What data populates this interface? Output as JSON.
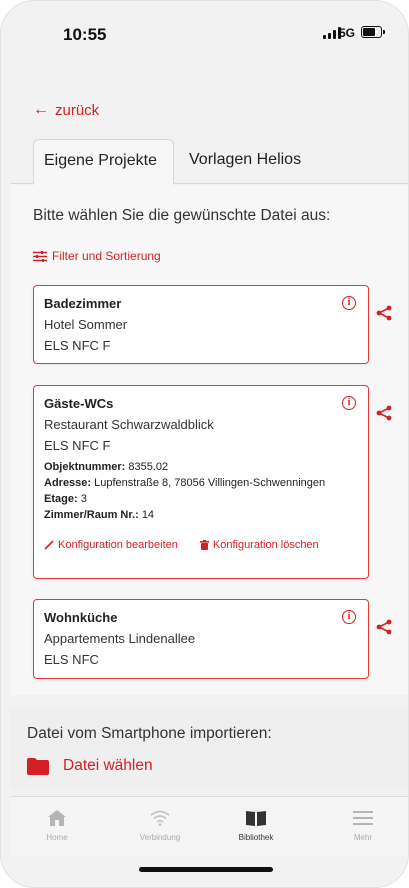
{
  "status": {
    "time": "10:55",
    "network": "5G"
  },
  "nav": {
    "back_label": "zurück"
  },
  "tabs": [
    {
      "label": "Eigene Projekte",
      "active": true
    },
    {
      "label": "Vorlagen Helios",
      "active": false
    }
  ],
  "prompt": "Bitte wählen Sie die gewünschte Datei aus:",
  "filter_label": "Filter und Sortierung",
  "projects": [
    {
      "name": "Badezimmer",
      "location": "Hotel Sommer",
      "product": "ELS NFC F"
    },
    {
      "name": "Gäste-WCs",
      "location": "Restaurant Schwarzwaldblick",
      "product": "ELS NFC F",
      "details": {
        "objekt_label": "Objektnummer:",
        "objekt_value": "8355.02",
        "adresse_label": "Adresse:",
        "adresse_value": "Lupfenstraße 8, 78056 Villingen-Schwenningen",
        "etage_label": "Etage:",
        "etage_value": "3",
        "zimmer_label": "Zimmer/Raum Nr.:",
        "zimmer_value": "14"
      },
      "edit_label": "Konfiguration bearbeiten",
      "delete_label": "Konfiguration löschen"
    },
    {
      "name": "Wohnküche",
      "location": "Appartements Lindenallee",
      "product": "ELS NFC"
    }
  ],
  "import": {
    "label": "Datei vom Smartphone importieren:",
    "button_label": "Datei wählen"
  },
  "tabbar": [
    {
      "label": "Home",
      "icon": "home-icon",
      "active": false
    },
    {
      "label": "Verbindung",
      "icon": "wifi-icon",
      "active": false
    },
    {
      "label": "Bibliothek",
      "icon": "book-icon",
      "active": true
    },
    {
      "label": "Mehr",
      "icon": "menu-icon",
      "active": false
    }
  ],
  "colors": {
    "accent": "#d31f25",
    "card_border": "#e23b3e"
  }
}
